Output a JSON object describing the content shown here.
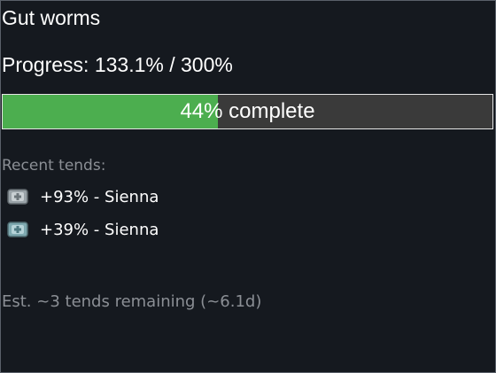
{
  "panel": {
    "title": "Gut worms",
    "progress_text": "Progress: 133.1% / 300%",
    "bar": {
      "percent_label": "44%",
      "suffix_label": "complete",
      "fraction": 0.44,
      "fill_color": "#4cae4f",
      "track_color": "#3a3a3a"
    },
    "recent_label": "Recent tends:",
    "tends": [
      {
        "icon": "medicine-kit-icon",
        "text": "+93% - Sienna"
      },
      {
        "icon": "medicine-kit-icon",
        "text": "+39% - Sienna"
      }
    ],
    "estimate": "Est. ~3 tends remaining (~6.1d)"
  }
}
